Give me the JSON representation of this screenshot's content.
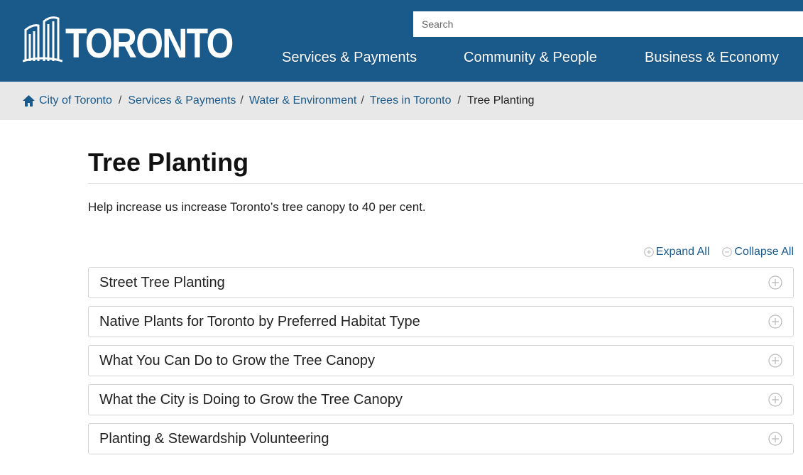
{
  "header": {
    "logo_text": "TORONTO",
    "search_placeholder": "Search",
    "nav": [
      {
        "label": "Services & Payments"
      },
      {
        "label": "Community & People"
      },
      {
        "label": "Business & Economy"
      }
    ]
  },
  "breadcrumb": {
    "items": [
      {
        "label": "City of Toronto"
      },
      {
        "label": "Services & Payments"
      },
      {
        "label": "Water & Environment"
      },
      {
        "label": "Trees in Toronto"
      }
    ],
    "current": "Tree Planting",
    "separator": "/"
  },
  "page": {
    "title": "Tree Planting",
    "intro": "Help increase us increase Toronto’s tree canopy to 40 per cent."
  },
  "controls": {
    "expand_all": "Expand All",
    "collapse_all": "Collapse All"
  },
  "accordion": [
    {
      "label": "Street Tree Planting"
    },
    {
      "label": "Native Plants for Toronto by Preferred Habitat Type"
    },
    {
      "label": "What You Can Do to Grow the Tree Canopy"
    },
    {
      "label": "What the City is Doing to Grow the Tree Canopy"
    },
    {
      "label": "Planting & Stewardship Volunteering"
    }
  ],
  "colors": {
    "brand_blue": "#1a5a8a",
    "breadcrumb_bg": "#e8e8e8"
  },
  "icons": {
    "home": "home-icon",
    "expand": "plus-circle-icon",
    "collapse": "minus-circle-icon"
  }
}
